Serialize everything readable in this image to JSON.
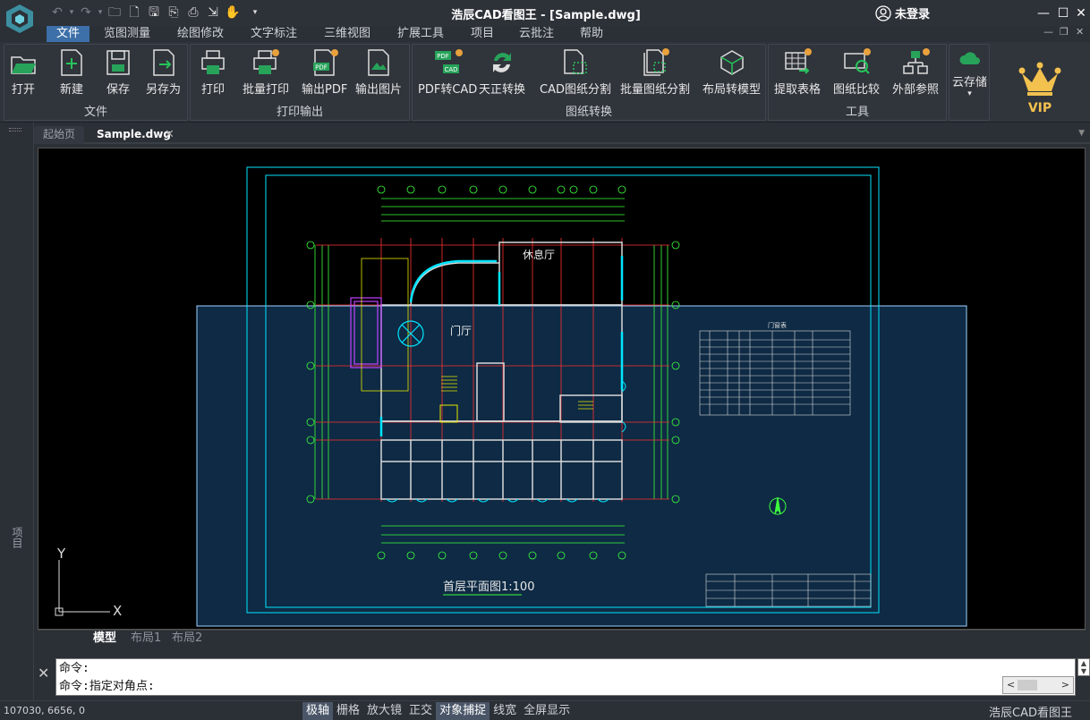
{
  "title": {
    "app": "浩辰CAD看图王 - [Sample.dwg]",
    "user": "未登录"
  },
  "menu": [
    "文件",
    "览图测量",
    "绘图修改",
    "文字标注",
    "三维视图",
    "扩展工具",
    "项目",
    "云批注",
    "帮助"
  ],
  "ribbon": {
    "groups": [
      "文件",
      "打印输出",
      "图纸转换",
      "工具"
    ],
    "tools": {
      "open": "打开",
      "new": "新建",
      "save": "保存",
      "saveas": "另存为",
      "print": "打印",
      "batchprint": "批量打印",
      "exportpdf": "输出PDF",
      "exportimg": "输出图片",
      "pdf2cad": "PDF转CAD",
      "tianzheng": "天正转换",
      "cadsplit": "CAD图纸分割",
      "batchsplit": "批量图纸分割",
      "layout2model": "布局转模型",
      "extracttable": "提取表格",
      "compare": "图纸比较",
      "xref": "外部参照",
      "cloud": "云存储"
    },
    "vip": "VIP"
  },
  "tabs": {
    "home": "起始页",
    "current": "Sample.dwg"
  },
  "sidepanel": "项目",
  "drawing": {
    "rooms": [
      "休息厅",
      "门厅"
    ],
    "plan_title": "首层平面图1:100",
    "table_title": "门窗表",
    "axis_y": "Y",
    "axis_x": "X"
  },
  "layouts": [
    "模型",
    "布局1",
    "布局2"
  ],
  "command": {
    "line1": "命令:",
    "line2": "命令:指定对角点:"
  },
  "status": {
    "coords": "107030, 6656, 0",
    "toggles": [
      {
        "label": "极轴",
        "on": true
      },
      {
        "label": "栅格",
        "on": false
      },
      {
        "label": "放大镜",
        "on": false
      },
      {
        "label": "正交",
        "on": false
      },
      {
        "label": "对象捕捉",
        "on": true
      },
      {
        "label": "线宽",
        "on": false
      },
      {
        "label": "全屏显示",
        "on": false
      }
    ],
    "brand": "浩辰CAD看图王"
  },
  "colors": {
    "accent": "#3d6fa8",
    "cyan": "#00e5ff",
    "selection": "#0e2a44",
    "green": "#3cff3c",
    "red": "#ff3030"
  }
}
